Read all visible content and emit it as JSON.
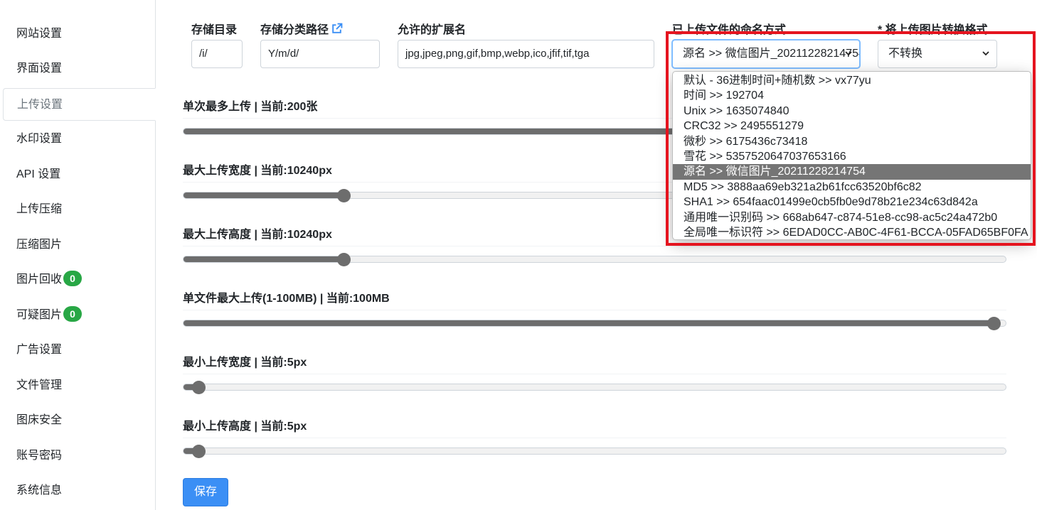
{
  "sidebar": {
    "items": [
      {
        "label": "网站设置"
      },
      {
        "label": "界面设置"
      },
      {
        "label": "上传设置"
      },
      {
        "label": "水印设置"
      },
      {
        "label": "API 设置"
      },
      {
        "label": "上传压缩"
      },
      {
        "label": "压缩图片"
      },
      {
        "label": "图片回收",
        "badge": "0"
      },
      {
        "label": "可疑图片",
        "badge": "0"
      },
      {
        "label": "广告设置"
      },
      {
        "label": "文件管理"
      },
      {
        "label": "图床安全"
      },
      {
        "label": "账号密码"
      },
      {
        "label": "系统信息"
      }
    ],
    "active": "上传设置"
  },
  "fields": {
    "storage_dir": {
      "label": "存储目录",
      "value": "/i/"
    },
    "storage_path": {
      "label": "存储分类路径",
      "value": "Y/m/d/",
      "icon": "external-link-icon"
    },
    "extensions": {
      "label": "允许的扩展名",
      "value": "jpg,jpeg,png,gif,bmp,webp,ico,jfif,tif,tga"
    },
    "naming": {
      "label": "已上传文件的命名方式",
      "value": "源名 >> 微信图片_20211228214754"
    },
    "convert": {
      "label": "* 将上传图片转换格式",
      "value": "不转换"
    }
  },
  "sliders": [
    {
      "label": "单次最多上传 | 当前:200张",
      "fraction": 0.98
    },
    {
      "label": "最大上传宽度 | 当前:10240px",
      "fraction": 0.195
    },
    {
      "label": "最大上传高度 | 当前:10240px",
      "fraction": 0.195
    },
    {
      "label": "单文件最大上传(1-100MB) | 当前:100MB",
      "fraction": 0.985
    },
    {
      "label": "最小上传宽度 | 当前:5px",
      "fraction": 0.018
    },
    {
      "label": "最小上传高度 | 当前:5px",
      "fraction": 0.018
    }
  ],
  "dropdown_options": [
    "默认 - 36进制时间+随机数 >> vx77yu",
    "时间 >> 192704",
    "Unix >> 1635074840",
    "CRC32 >> 2495551279",
    "微秒 >> 6175436c73418",
    "雪花 >> 5357520647037653166",
    "源名 >> 微信图片_20211228214754",
    "MD5 >> 3888aa69eb321a2b61fcc63520bf6c82",
    "SHA1 >> 654faac01499e0cb5fb0e9d78b21e234c63d842a",
    "通用唯一识别码 >> 668ab647-c874-51e8-cc98-ac5c24a472b0",
    "全局唯一标识符 >> 6EDAD0CC-AB0C-4F61-BCCA-05FAD65BF0FA"
  ],
  "selected_option_index": 6,
  "save_label": "保存",
  "colors": {
    "accent": "#3b8ff5",
    "badge": "#28a745",
    "highlight": "#e5141f"
  }
}
